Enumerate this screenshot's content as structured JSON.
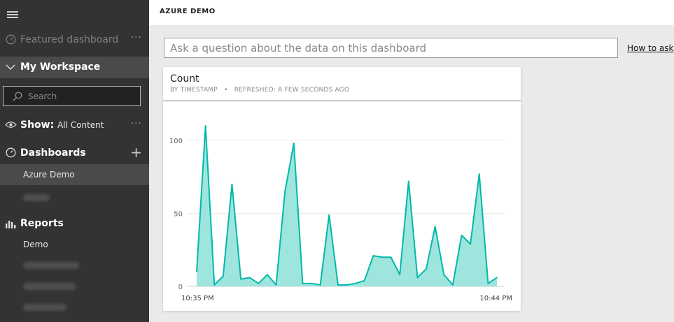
{
  "header": {
    "title": "AZURE DEMO"
  },
  "sidebar": {
    "featured_label": "Featured dashboard",
    "featured_more": "···",
    "workspace_label": "My Workspace",
    "search_placeholder": "Search",
    "show_label": "Show:",
    "show_value": "All Content",
    "show_more": "···",
    "dashboards_label": "Dashboards",
    "dashboards_add": "+",
    "dashboards_items": [
      "Azure Demo"
    ],
    "reports_label": "Reports",
    "reports_items": [
      "Demo"
    ]
  },
  "qa": {
    "placeholder": "Ask a question about the data on this dashboard",
    "how_to_ask": "How to ask"
  },
  "tile": {
    "title": "Count",
    "subtitle": "BY TIMESTAMP",
    "bullet": "•",
    "refreshed": "REFRESHED: A FEW SECONDS AGO"
  },
  "chart_data": {
    "type": "area",
    "title": "Count",
    "xlabel": "",
    "ylabel": "",
    "x_tick_labels": [
      "10:35 PM",
      "10:44 PM"
    ],
    "y_ticks": [
      0,
      50,
      100
    ],
    "ylim": [
      0,
      115
    ],
    "color": "#01b8aa",
    "fill": "#9ee5de",
    "grid": true,
    "values": [
      10,
      110,
      1,
      7,
      70,
      5,
      6,
      2,
      8,
      1,
      65,
      98,
      2,
      2,
      1,
      49,
      1,
      1,
      2,
      4,
      21,
      20,
      20,
      8,
      72,
      6,
      12,
      41,
      8,
      1,
      35,
      29,
      77,
      2,
      6
    ]
  }
}
